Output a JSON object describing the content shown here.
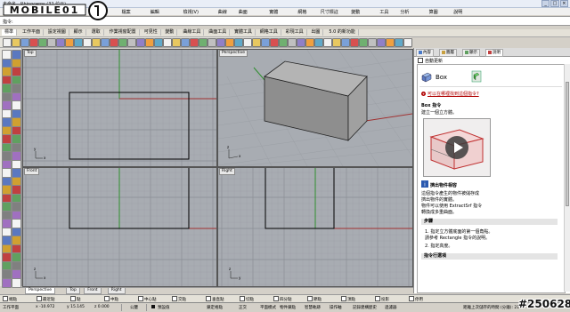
{
  "app": {
    "title": "未命名 - Rhinoceros (32 位元)",
    "window_controls": [
      "_",
      "□",
      "×"
    ]
  },
  "logo": {
    "text": "MOBILE01"
  },
  "menu": {
    "items": [
      "檔案",
      "編輯",
      "檢視(V)",
      "曲線",
      "曲面",
      "實體",
      "網格",
      "尺寸標註",
      "變動",
      "工具",
      "分析",
      "算圖",
      "說明"
    ]
  },
  "command": {
    "label": "指令:",
    "value": ""
  },
  "toolbar_tabs": {
    "items": [
      "標準",
      "工作平面",
      "設定視圖",
      "顯示",
      "選取",
      "作業視窗配置",
      "可見性",
      "變動",
      "曲線工具",
      "曲面工具",
      "實體工具",
      "網格工具",
      "彩現工具",
      "出圖",
      "5.0 的新功能"
    ],
    "active": 0
  },
  "viewports": {
    "top": {
      "title": "Top"
    },
    "perspective": {
      "title": "Perspective"
    },
    "front": {
      "title": "Front"
    },
    "right": {
      "title": "Right"
    },
    "tabs": [
      "Perspective",
      "Top",
      "Front",
      "Right"
    ],
    "axis_labels": {
      "x": "x",
      "y": "y",
      "z": "z"
    }
  },
  "snaps": {
    "items": [
      "端點",
      "最近點",
      "點",
      "中點",
      "中心點",
      "交點",
      "垂直點",
      "切點",
      "四分點",
      "節點",
      "頂點",
      "投影",
      "停用"
    ]
  },
  "status": {
    "plane": "工作平面",
    "x": "x -10.972",
    "y": "y 15.145",
    "z": "z 0.000",
    "unit": "公釐",
    "layer": "預設值",
    "toggles": [
      "鎖定格點",
      "正交",
      "平面模式",
      "物件鎖點",
      "智慧軌跡",
      "操作軸",
      "記錄建構歷史",
      "過濾器"
    ],
    "cpu": "距離上次儲存的時間 (分鐘): 21"
  },
  "right_panel": {
    "tabs": [
      "內容",
      "圖層",
      "顯示",
      "說明"
    ],
    "active_tab": 3,
    "auto_update": "自動更新",
    "help": {
      "command_name": "Box",
      "where_link": "可以在哪裡找到這個指令?",
      "section_title": "Box 指令",
      "description": "建立一個立方體。",
      "sub_title": "擠出物件相容",
      "paragraph": [
        "這個指令產生的物件被儲存成",
        "擠出物件的實體。",
        "物件可以使用 ExtractSrf 指令",
        "轉換成多重曲面。"
      ],
      "steps_title": "步驟",
      "steps": [
        "1. 指定立方體底面的第一個角點。",
        "   請參考 Rectangle 指令的說明。",
        "2. 指定高度。"
      ],
      "options_title": "指令行選項",
      "colors": {
        "link": "#b00000"
      }
    }
  },
  "watermark": "#250628",
  "colors": {
    "viewport_bg": "#a8acb2",
    "grid": "#9ca0a6",
    "grid_major": "#8a8e94",
    "axis_x": "#a03030",
    "axis_y": "#2f8f2f",
    "box_side": "#8e8e8e",
    "box_top": "#b4b4b4"
  }
}
